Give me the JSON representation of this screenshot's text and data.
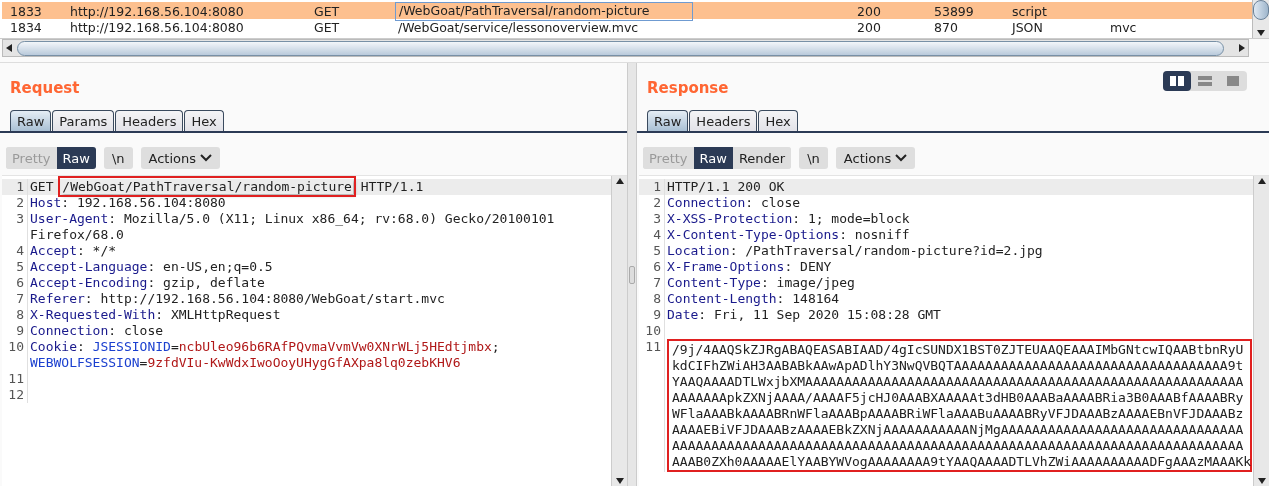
{
  "requests_table": {
    "rows": [
      {
        "selected": true,
        "focused": true,
        "column_1": "1833",
        "column_2": "http://192.168.56.104:8080",
        "column_3": "GET",
        "column_4": "/WebGoat/PathTraversal/random-picture",
        "column_5": "200",
        "column_6": "53899",
        "column_7": "script"
      },
      {
        "selected": false,
        "focused": false,
        "column_1": "1834",
        "column_2": "http://192.168.56.104:8080",
        "column_3": "GET",
        "column_4": "/WebGoat/service/lessonoverview.mvc",
        "column_5": "200",
        "column_6": "870",
        "column_7": "JSON",
        "column_8": "mvc"
      }
    ]
  },
  "request": {
    "title": "Request",
    "tabs": [
      {
        "label": "Raw",
        "selected": true
      },
      {
        "label": "Params",
        "selected": false
      },
      {
        "label": "Headers",
        "selected": false
      },
      {
        "label": "Hex",
        "selected": false
      }
    ],
    "format_buttons": [
      {
        "label": "Pretty",
        "selected": false,
        "disabled": true
      },
      {
        "label": "Raw",
        "selected": true,
        "disabled": false
      }
    ],
    "newline_button": "\\n",
    "actions_button": "Actions",
    "lines": [
      {
        "number": "1",
        "current": true,
        "rows": [
          {
            "parts": [
              {
                "kind": "plain",
                "text": "GET "
              },
              {
                "kind": "plain",
                "text": "/WebGoat/PathTraversal/random-picture",
                "boxed": true
              },
              {
                "kind": "plain",
                "text": " HTTP/1.1"
              }
            ]
          }
        ]
      },
      {
        "number": "2",
        "current": false,
        "rows": [
          {
            "parts": [
              {
                "kind": "key",
                "text": "Host"
              },
              {
                "kind": "plain",
                "text": ": 192.168.56.104:8080"
              }
            ]
          }
        ]
      },
      {
        "number": "3",
        "current": false,
        "rows": [
          {
            "parts": [
              {
                "kind": "key",
                "text": "User-Agent"
              },
              {
                "kind": "plain",
                "text": ": Mozilla/5.0 (X11; Linux x86_64; rv:68.0) Gecko/20100101"
              }
            ]
          },
          {
            "parts": [
              {
                "kind": "plain",
                "text": "Firefox/68.0"
              }
            ]
          }
        ]
      },
      {
        "number": "4",
        "current": false,
        "rows": [
          {
            "parts": [
              {
                "kind": "key",
                "text": "Accept"
              },
              {
                "kind": "plain",
                "text": ": */*"
              }
            ]
          }
        ]
      },
      {
        "number": "5",
        "current": false,
        "rows": [
          {
            "parts": [
              {
                "kind": "key",
                "text": "Accept-Language"
              },
              {
                "kind": "plain",
                "text": ": en-US,en;q=0.5"
              }
            ]
          }
        ]
      },
      {
        "number": "6",
        "current": false,
        "rows": [
          {
            "parts": [
              {
                "kind": "key",
                "text": "Accept-Encoding"
              },
              {
                "kind": "plain",
                "text": ": gzip, deflate"
              }
            ]
          }
        ]
      },
      {
        "number": "7",
        "current": false,
        "rows": [
          {
            "parts": [
              {
                "kind": "key",
                "text": "Referer"
              },
              {
                "kind": "plain",
                "text": ": http://192.168.56.104:8080/WebGoat/start.mvc"
              }
            ]
          }
        ]
      },
      {
        "number": "8",
        "current": false,
        "rows": [
          {
            "parts": [
              {
                "kind": "key",
                "text": "X-Requested-With"
              },
              {
                "kind": "plain",
                "text": ": XMLHttpRequest"
              }
            ]
          }
        ]
      },
      {
        "number": "9",
        "current": false,
        "rows": [
          {
            "parts": [
              {
                "kind": "key",
                "text": "Connection"
              },
              {
                "kind": "plain",
                "text": ": close"
              }
            ]
          }
        ]
      },
      {
        "number": "10",
        "current": false,
        "rows": [
          {
            "parts": [
              {
                "kind": "key",
                "text": "Cookie"
              },
              {
                "kind": "plain",
                "text": ": "
              },
              {
                "kind": "cookie_name",
                "text": "JSESSIONID"
              },
              {
                "kind": "plain",
                "text": "="
              },
              {
                "kind": "cookie_value",
                "text": "ncbUleo96b6RAfPQvmaVvmVw0XNrWLj5HEdtjmbx"
              },
              {
                "kind": "plain",
                "text": ";"
              }
            ]
          },
          {
            "parts": [
              {
                "kind": "cookie_name",
                "text": "WEBWOLFSESSION"
              },
              {
                "kind": "plain",
                "text": "="
              },
              {
                "kind": "cookie_value",
                "text": "9zfdVIu-KwWdxIwoOoyUHygGfAXpa8lq0zebKHV6"
              }
            ]
          }
        ]
      },
      {
        "number": "11",
        "current": false
      },
      {
        "number": "12",
        "current": false
      }
    ]
  },
  "response": {
    "title": "Response",
    "layout_toggle": [
      {
        "kind": "columns",
        "selected": true
      },
      {
        "kind": "rows",
        "selected": false
      },
      {
        "kind": "single",
        "selected": false
      }
    ],
    "tabs": [
      {
        "label": "Raw",
        "selected": true
      },
      {
        "label": "Headers",
        "selected": false
      },
      {
        "label": "Hex",
        "selected": false
      }
    ],
    "format_buttons": [
      {
        "label": "Pretty",
        "selected": false,
        "disabled": true
      },
      {
        "label": "Raw",
        "selected": true,
        "disabled": false
      },
      {
        "label": "Render",
        "selected": false,
        "disabled": false
      }
    ],
    "newline_button": "\\n",
    "actions_button": "Actions",
    "lines": [
      {
        "number": "1",
        "current": true,
        "rows": [
          {
            "parts": [
              {
                "kind": "plain",
                "text": "HTTP/1.1 200 OK"
              }
            ]
          }
        ]
      },
      {
        "number": "2",
        "current": false,
        "rows": [
          {
            "parts": [
              {
                "kind": "key",
                "text": "Connection"
              },
              {
                "kind": "plain",
                "text": ": close"
              }
            ]
          }
        ]
      },
      {
        "number": "3",
        "current": false,
        "rows": [
          {
            "parts": [
              {
                "kind": "key",
                "text": "X-XSS-Protection"
              },
              {
                "kind": "plain",
                "text": ": 1; mode=block"
              }
            ]
          }
        ]
      },
      {
        "number": "4",
        "current": false,
        "rows": [
          {
            "parts": [
              {
                "kind": "key",
                "text": "X-Content-Type-Options"
              },
              {
                "kind": "plain",
                "text": ": nosniff"
              }
            ]
          }
        ]
      },
      {
        "number": "5",
        "current": false,
        "rows": [
          {
            "parts": [
              {
                "kind": "key",
                "text": "Location"
              },
              {
                "kind": "plain",
                "text": ": /PathTraversal/random-picture?id=2.jpg"
              }
            ]
          }
        ]
      },
      {
        "number": "6",
        "current": false,
        "rows": [
          {
            "parts": [
              {
                "kind": "key",
                "text": "X-Frame-Options"
              },
              {
                "kind": "plain",
                "text": ": DENY"
              }
            ]
          }
        ]
      },
      {
        "number": "7",
        "current": false,
        "rows": [
          {
            "parts": [
              {
                "kind": "key",
                "text": "Content-Type"
              },
              {
                "kind": "plain",
                "text": ": image/jpeg"
              }
            ]
          }
        ]
      },
      {
        "number": "8",
        "current": false,
        "rows": [
          {
            "parts": [
              {
                "kind": "key",
                "text": "Content-Length"
              },
              {
                "kind": "plain",
                "text": ": 148164"
              }
            ]
          }
        ]
      },
      {
        "number": "9",
        "current": false,
        "rows": [
          {
            "parts": [
              {
                "kind": "key",
                "text": "Date"
              },
              {
                "kind": "plain",
                "text": ": Fri, 11 Sep 2020 15:08:28 GMT"
              }
            ]
          }
        ]
      },
      {
        "number": "10",
        "current": false
      },
      {
        "number": "11",
        "current": false,
        "boxed": true,
        "rows": [
          {
            "parts": [
              {
                "kind": "plain",
                "text": "/9j/4AAQSkZJRgABAQEASABIAAD/4gIcSUNDX1BST0ZJTEUAAQEAAAIMbGNtcwIQAABtbnRyU"
              }
            ]
          },
          {
            "parts": [
              {
                "kind": "plain",
                "text": "kdCIFhZWiAH3AABABkAAwApADlhY3NwQVBQTAAAAAAAAAAAAAAAAAAAAAAAAAAAAAAAAAAA9t"
              }
            ]
          },
          {
            "parts": [
              {
                "kind": "plain",
                "text": "YAAQAAAADTLWxjbXMAAAAAAAAAAAAAAAAAAAAAAAAAAAAAAAAAAAAAAAAAAAAAAAAAAAAAAAA"
              }
            ]
          },
          {
            "parts": [
              {
                "kind": "plain",
                "text": "AAAAAAApkZXNjAAAA/AAAAF5jcHJ0AAABXAAAAAt3dHB0AAABaAAAABRia3B0AAABfAAAABRy"
              }
            ]
          },
          {
            "parts": [
              {
                "kind": "plain",
                "text": "WFlaAAABkAAAABRnWFlaAAABpAAAABRiWFlaAAABuAAAABRyVFJDAAABzAAAAEBnVFJDAAABz"
              }
            ]
          },
          {
            "parts": [
              {
                "kind": "plain",
                "text": "AAAAEBiVFJDAAABzAAAAEBkZXNjAAAAAAAAAAANjMgAAAAAAAAAAAAAAAAAAAAAAAAAAAAAAA"
              }
            ]
          },
          {
            "parts": [
              {
                "kind": "plain",
                "text": "AAAAAAAAAAAAAAAAAAAAAAAAAAAAAAAAAAAAAAAAAAAAAAAAAAAAAAAAAAAAAAAAAAAAAAAAA"
              }
            ]
          },
          {
            "parts": [
              {
                "kind": "plain",
                "text": "AAAB0ZXh0AAAAAElYAABYWVogAAAAAAAA9tYAAQAAAADTLVhZWiAAAAAAAAAADFgAAAzMAAAKk"
              }
            ]
          }
        ]
      }
    ]
  }
}
